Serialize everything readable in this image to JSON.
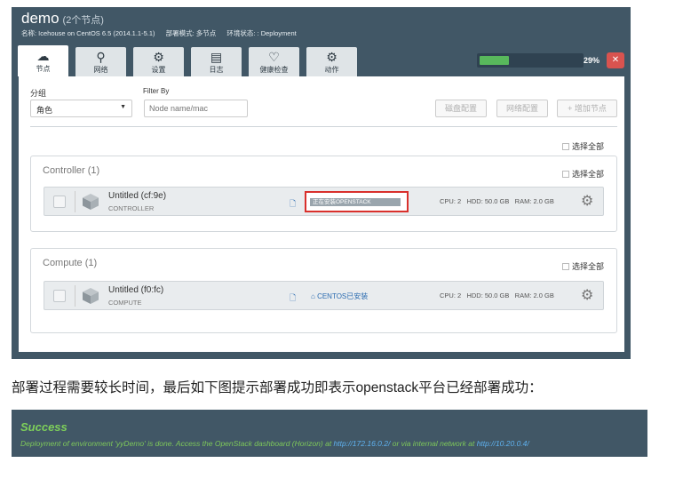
{
  "environment": {
    "name": "demo",
    "node_count": "(2个节点)",
    "meta": {
      "name": "名称: Icehouse on CentOS 6.5 (2014.1.1-5.1)",
      "mode": "部署模式: 多节点",
      "status": "环境状态: : Deployment"
    }
  },
  "tabs": [
    {
      "label": "节点",
      "icon": "cloud-icon"
    },
    {
      "label": "网络",
      "icon": "network-icon"
    },
    {
      "label": "设置",
      "icon": "gear-icon"
    },
    {
      "label": "日志",
      "icon": "log-icon"
    },
    {
      "label": "健康检查",
      "icon": "heart-icon"
    },
    {
      "label": "动作",
      "icon": "actions-icon"
    }
  ],
  "deploy_progress": {
    "label": "29%",
    "value": 0.29,
    "close_label": "✕"
  },
  "toolbar": {
    "group_label": "分组",
    "group_value": "角色",
    "filter_label": "Filter By",
    "filter_placeholder": "Node name/mac",
    "disk_config": "磁盘配置",
    "net_config": "网络配置",
    "add_node": "增加节点"
  },
  "select_all": "选择全部",
  "groups": [
    {
      "title": "Controller (1)",
      "select_all": "选择全部",
      "node": {
        "name": "Untitled (cf:9e)",
        "role": "CONTROLLER",
        "status": "正在安装OPENSTACK",
        "cpu": "CPU: 2",
        "hdd": "HDD: 50.0 GB",
        "ram": "RAM: 2.0 GB"
      }
    },
    {
      "title": "Compute (1)",
      "select_all": "选择全部",
      "node": {
        "name": "Untitled (f0:fc)",
        "role": "COMPUTE",
        "status": "CENTOS已安装",
        "cpu": "CPU: 2",
        "hdd": "HDD: 50.0 GB",
        "ram": "RAM: 2.0 GB"
      }
    }
  ],
  "caption": "部署过程需要较长时间，最后如下图提示部署成功即表示openstack平台已经部署成功：",
  "success": {
    "title": "Success",
    "message_pre": "Deployment of environment 'yyDemo' is done. Access the OpenStack dashboard (Horizon) at ",
    "link1": "http://172.16.0.2/",
    "message_mid": " or via internal network at ",
    "link2": "http://10.20.0.4/"
  },
  "colors": {
    "header_bg": "#415766",
    "progress_fill": "#58b85c",
    "stop_button": "#d9534f",
    "highlight_border": "#d9302c",
    "success_green": "#7ed05a",
    "link_blue": "#5fb2f0"
  }
}
